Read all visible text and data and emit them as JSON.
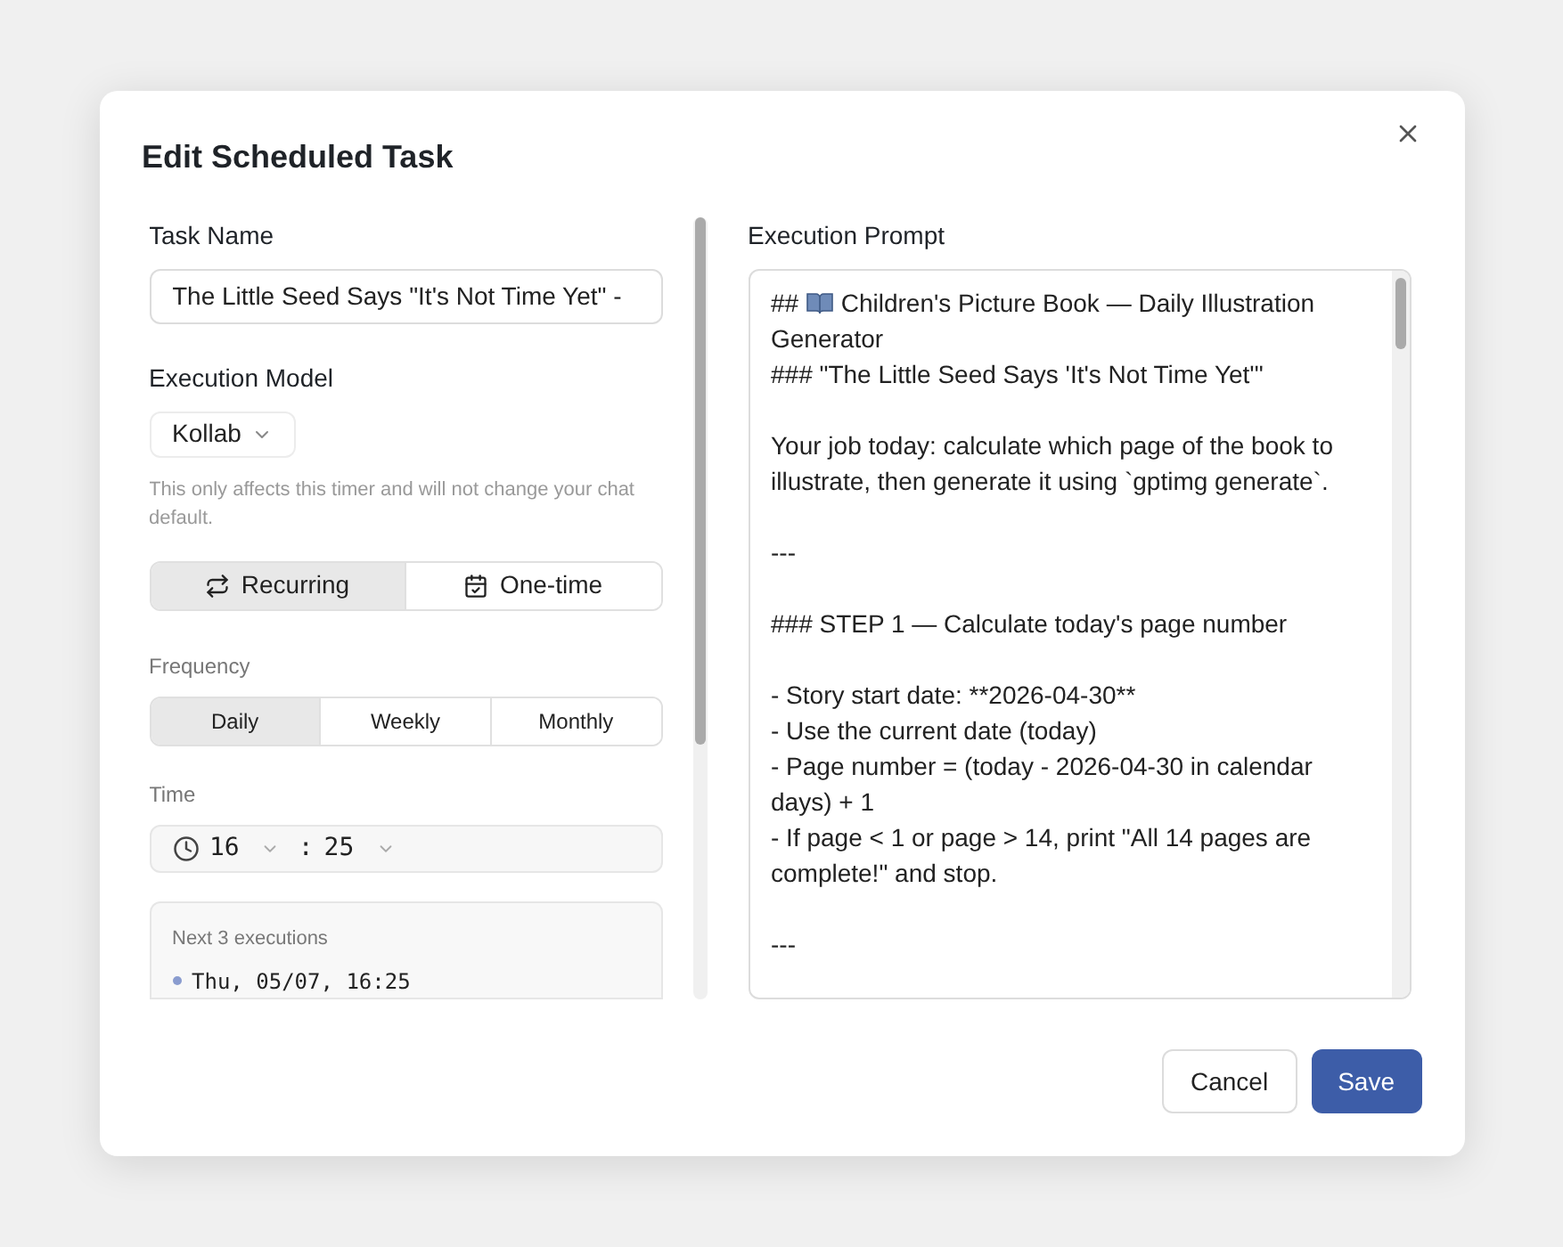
{
  "dialog": {
    "title": "Edit Scheduled Task"
  },
  "task_name": {
    "label": "Task Name",
    "value": "The Little Seed Says \"It's Not Time Yet\" -"
  },
  "model": {
    "label": "Execution Model",
    "value": "Kollab",
    "hint": "This only affects this timer and will not change your chat default."
  },
  "schedule_types": [
    {
      "label": "Recurring",
      "kind": "recurring",
      "selected": true
    },
    {
      "label": "One-time",
      "kind": "onetime",
      "selected": false
    }
  ],
  "frequency": {
    "label": "Frequency",
    "options": [
      {
        "label": "Daily",
        "selected": true
      },
      {
        "label": "Weekly",
        "selected": false
      },
      {
        "label": "Monthly",
        "selected": false
      }
    ]
  },
  "time": {
    "label": "Time",
    "hour": "16",
    "separator": ":",
    "minute": "25"
  },
  "next_executions": {
    "title": "Next 3 executions",
    "items": [
      "Thu, 05/07, 16:25"
    ]
  },
  "prompt": {
    "label": "Execution Prompt",
    "heading_prefix": "##",
    "heading": "Children's Picture Book — Daily Illustration Generator",
    "paragraphs": [
      [
        "### \"The Little Seed Says 'It's Not Time Yet'\""
      ],
      [
        "Your job today: calculate which page of the book to illustrate, then generate it using `gptimg generate`."
      ],
      [
        "---"
      ],
      [
        "### STEP 1 — Calculate today's page number"
      ],
      [
        "- Story start date: **2026-04-30**",
        "- Use the current date (today)",
        "- Page number = (today - 2026-04-30 in calendar days) + 1",
        "- If page < 1 or page > 14, print \"All 14 pages are complete!\" and stop."
      ],
      [
        "---"
      ]
    ]
  },
  "buttons": [
    {
      "label": "Cancel",
      "kind": "secondary"
    },
    {
      "label": "Save",
      "kind": "primary"
    }
  ]
}
